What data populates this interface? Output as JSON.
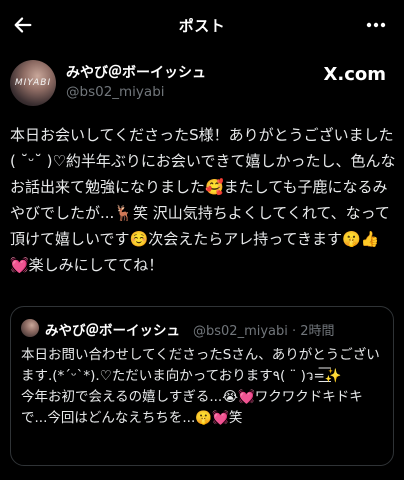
{
  "header": {
    "title": "ポスト",
    "back_icon": "back-arrow-icon",
    "more_icon": "more-options-icon"
  },
  "author": {
    "avatar_text": "MIYABI",
    "display_name": "みやび＠ボーイッシュ",
    "username": "@bs02_miyabi"
  },
  "source_badge": "X.com",
  "post": {
    "text": "本日お会いしてくださったS様！ありがとうございました( ˘ᵕ˘ )♡約半年ぶりにお会いできて嬉しかったし、色んなお話出来て勉強になりました🥰またしても子鹿になるみやびでしたが...🦌笑 沢山気持ちよくしてくれて、なって頂けて嬉しいです☺️次会えたらアレ持ってきます🤫👍💓楽しみにしててね！"
  },
  "quote": {
    "display_name": "みやび＠ボーイッシュ",
    "meta": "@bs02_miyabi · 2時間",
    "text": "本日お問い合わせしてくださったSさん、ありがとうございます.(*ˊᵕˋ*).♡ただいま向かっております٩( ¨ )ว=͟͟͞͞✨\n今年お初で会えるの嬉しすぎる...😭💓ワクワクドキドキで...今回はどんなえちちを...🤫💓笑"
  }
}
